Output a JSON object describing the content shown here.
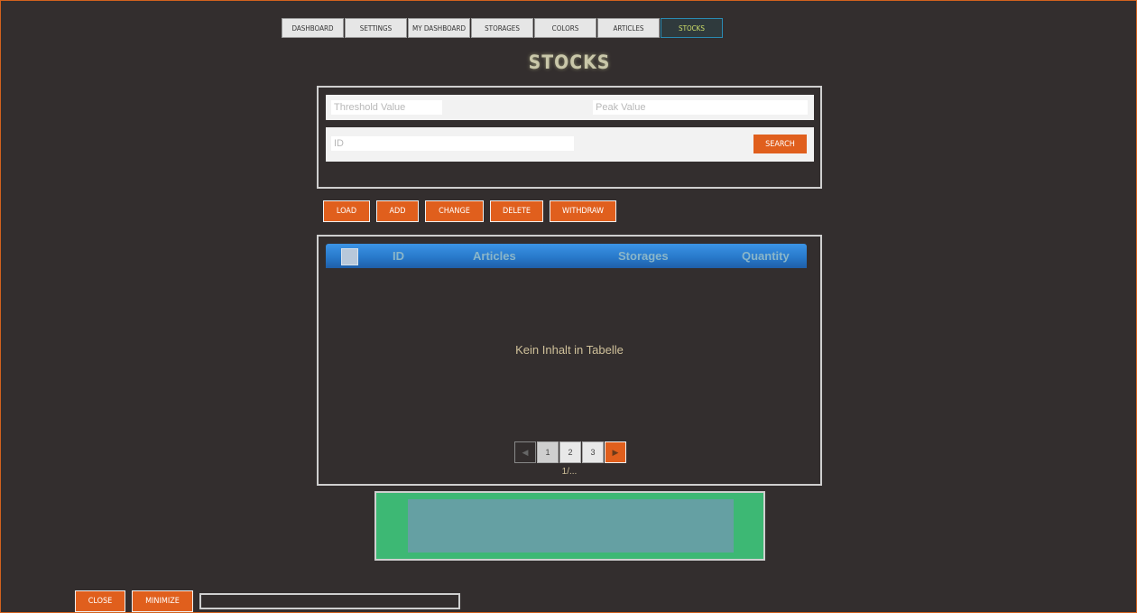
{
  "tabs": [
    {
      "label": "DASHBOARD"
    },
    {
      "label": "SETTINGS"
    },
    {
      "label": "MY DASHBOARD"
    },
    {
      "label": "STORAGES"
    },
    {
      "label": "COLORS"
    },
    {
      "label": "ARTICLES"
    },
    {
      "label": "STOCKS",
      "active": true
    }
  ],
  "page_title": "STOCKS",
  "filter": {
    "threshold_placeholder": "Threshold Value",
    "peak_placeholder": "Peak Value",
    "id_placeholder": "ID",
    "search_label": "SEARCH"
  },
  "actions": {
    "load": "LOAD",
    "add": "ADD",
    "change": "CHANGE",
    "delete": "DELETE",
    "withdraw": "WITHDRAW"
  },
  "table": {
    "columns": [
      "ID",
      "Articles",
      "Storages",
      "Quantity"
    ],
    "empty_message": "Kein Inhalt in Tabelle"
  },
  "pagination": {
    "prev": "◀",
    "pages": [
      "1",
      "2",
      "3"
    ],
    "next": "▶",
    "info": "1/..."
  },
  "footer": {
    "close": "CLOSE",
    "minimize": "MINIMIZE"
  },
  "colors": {
    "background": "#332e2e",
    "accent": "#e05f1d",
    "header_blue": "#2777c8",
    "green": "#3db874"
  }
}
